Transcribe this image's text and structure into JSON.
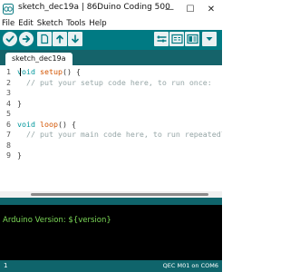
{
  "window": {
    "title": "sketch_dec19a | 86Duino Coding 500",
    "minimize": "—",
    "maximize": "☐",
    "close": "✕"
  },
  "menu": [
    "File",
    "Edit",
    "Sketch",
    "Tools",
    "Help"
  ],
  "toolbar": {
    "left_buttons": [
      "verify-icon",
      "upload-icon",
      "new-icon",
      "open-icon",
      "save-icon"
    ],
    "right_buttons": [
      "serial-plotter-icon",
      "serial-monitor-icon",
      "board-panel-icon",
      "dropdown-icon"
    ]
  },
  "tabs": [
    {
      "label": "sketch_dec19a"
    }
  ],
  "editor": {
    "lines": [
      {
        "n": "1",
        "parts": [
          {
            "t": "void",
            "c": "kw"
          },
          {
            "t": " ",
            "c": ""
          },
          {
            "t": "setup",
            "c": "fn"
          },
          {
            "t": "() {",
            "c": ""
          }
        ]
      },
      {
        "n": "2",
        "parts": [
          {
            "t": "  // put your setup code here, to run once:",
            "c": "cm"
          }
        ]
      },
      {
        "n": "3",
        "parts": []
      },
      {
        "n": "4",
        "parts": [
          {
            "t": "}",
            "c": ""
          }
        ]
      },
      {
        "n": "5",
        "parts": []
      },
      {
        "n": "6",
        "parts": [
          {
            "t": "void",
            "c": "kw"
          },
          {
            "t": " ",
            "c": ""
          },
          {
            "t": "loop",
            "c": "fn"
          },
          {
            "t": "() {",
            "c": ""
          }
        ]
      },
      {
        "n": "7",
        "parts": [
          {
            "t": "  // put your main code here, to run repeatedly:",
            "c": "cm"
          }
        ]
      },
      {
        "n": "8",
        "parts": []
      },
      {
        "n": "9",
        "parts": [
          {
            "t": "}",
            "c": ""
          }
        ]
      }
    ]
  },
  "console": {
    "text": "Arduino Version: ${version}"
  },
  "status": {
    "line": "1",
    "board": "QEC M01 on COM6"
  },
  "colors": {
    "toolbar": "#007a83",
    "tabstrip": "#15636a",
    "status": "#0f646b",
    "keyword": "#00979c",
    "function": "#d35400",
    "comment": "#95a5a6",
    "console_text": "#7cd957"
  }
}
